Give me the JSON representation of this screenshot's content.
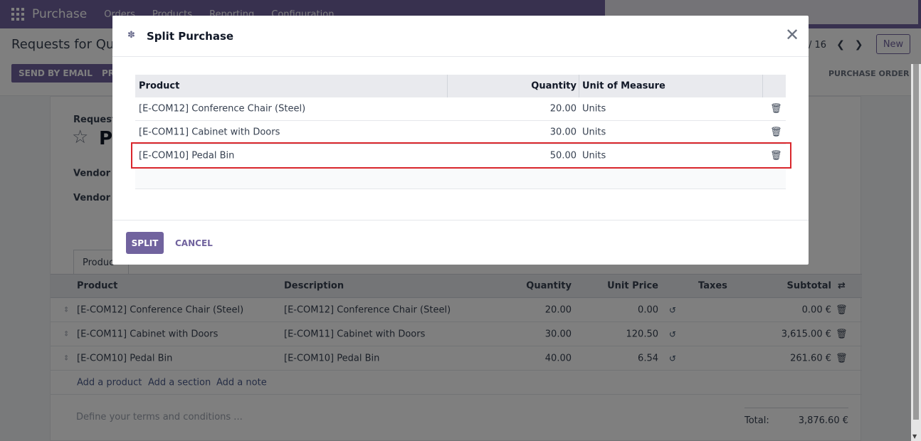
{
  "navbar": {
    "app_name": "Purchase",
    "menu": [
      "Orders",
      "Products",
      "Reporting",
      "Configuration"
    ]
  },
  "control": {
    "breadcrumb": "Requests for Quo",
    "pager": "/ 16",
    "new_label": "New",
    "send_email_label": "SEND BY EMAIL",
    "print_label": "PR",
    "stage_label": "PURCHASE ORDER"
  },
  "form": {
    "request_label": "Request f",
    "po_name": "P(",
    "vendor_label": "Vendor",
    "vendor_help": "?",
    "vendor_ref_label": "Vendor R",
    "tab_products": "Produc",
    "columns": [
      "Product",
      "Description",
      "Quantity",
      "Unit Price",
      "Taxes",
      "Subtotal"
    ],
    "lines": [
      {
        "product": "[E-COM12] Conference Chair (Steel)",
        "description": "[E-COM12] Conference Chair (Steel)",
        "quantity": "20.00",
        "unit_price": "0.00",
        "subtotal": "0.00 €"
      },
      {
        "product": "[E-COM11] Cabinet with Doors",
        "description": "[E-COM11] Cabinet with Doors",
        "quantity": "30.00",
        "unit_price": "120.50",
        "subtotal": "3,615.00 €"
      },
      {
        "product": "[E-COM10] Pedal Bin",
        "description": "[E-COM10] Pedal Bin",
        "quantity": "40.00",
        "unit_price": "6.54",
        "subtotal": "261.60 €"
      }
    ],
    "add_product": "Add a product",
    "add_section": "Add a section",
    "add_note": "Add a note",
    "terms_placeholder": "Define your terms and conditions ...",
    "total_label": "Total:",
    "total_value": "3,876.60 €"
  },
  "modal": {
    "title": "Split Purchase",
    "columns": [
      "Product",
      "Quantity",
      "Unit of Measure"
    ],
    "rows": [
      {
        "product": "[E-COM12] Conference Chair (Steel)",
        "quantity": "20.00",
        "uom": "Units"
      },
      {
        "product": "[E-COM11] Cabinet with Doors",
        "quantity": "30.00",
        "uom": "Units"
      },
      {
        "product": "[E-COM10] Pedal Bin",
        "quantity": "50.00",
        "uom": "Units"
      }
    ],
    "split_label": "SPLIT",
    "cancel_label": "CANCEL"
  },
  "colors": {
    "brand": "#71639e",
    "highlight": "#d9262c"
  }
}
